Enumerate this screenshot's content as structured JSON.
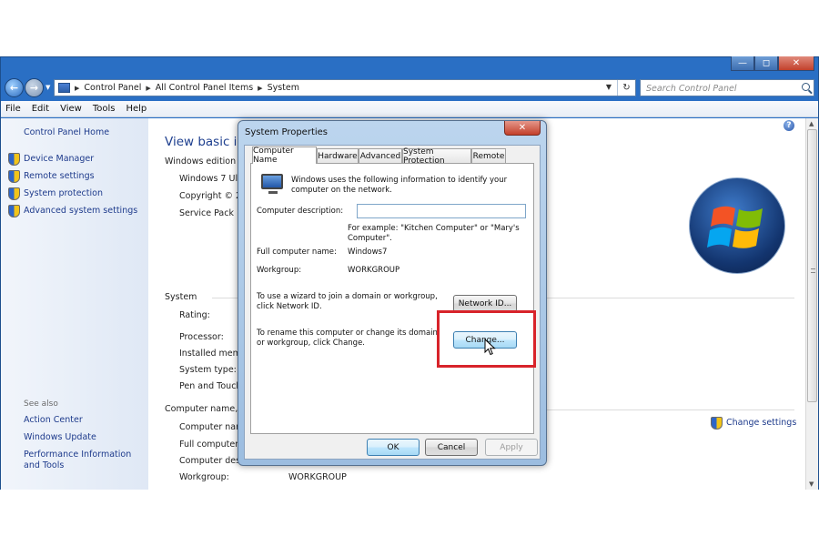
{
  "window": {
    "caption_buttons": {
      "minimize": "—",
      "maximize": "◻",
      "close": "✕"
    }
  },
  "navbar": {
    "back_glyph": "←",
    "forward_glyph": "→",
    "breadcrumb": [
      "Control Panel",
      "All Control Panel Items",
      "System"
    ],
    "search_placeholder": "Search Control Panel"
  },
  "menubar": [
    "File",
    "Edit",
    "View",
    "Tools",
    "Help"
  ],
  "left_pane": {
    "home": "Control Panel Home",
    "tasks": [
      "Device Manager",
      "Remote settings",
      "System protection",
      "Advanced system settings"
    ],
    "see_also_label": "See also",
    "see_also": [
      "Action Center",
      "Windows Update",
      "Performance Information and Tools"
    ]
  },
  "content": {
    "title": "View basic info",
    "windows_edition": {
      "header": "Windows edition",
      "rows": [
        "Windows 7 Ulti",
        "Copyright © 20",
        "Service Pack 1"
      ]
    },
    "system": {
      "header": "System",
      "rows": [
        "Rating:",
        "Processor:",
        "Installed memo",
        "System type:",
        "Pen and Touch"
      ]
    },
    "computer_name": {
      "header": "Computer name, d",
      "rows": [
        "Computer nam",
        "Full computer n",
        "Computer desc",
        "Workgroup:"
      ],
      "workgroup_value": "WORKGROUP"
    },
    "change_settings": "Change settings",
    "help_glyph": "?"
  },
  "dialog": {
    "title": "System Properties",
    "close_glyph": "✕",
    "tabs": [
      "Computer Name",
      "Hardware",
      "Advanced",
      "System Protection",
      "Remote"
    ],
    "intro": "Windows uses the following information to identify your computer on the network.",
    "description_label": "Computer description:",
    "description_value": "",
    "example": "For example: \"Kitchen Computer\" or \"Mary's Computer\".",
    "full_name_label": "Full computer name:",
    "full_name_value": "Windows7",
    "workgroup_label": "Workgroup:",
    "workgroup_value": "WORKGROUP",
    "network_id_text": "To use a wizard to join a domain or workgroup, click Network ID.",
    "network_id_button": "Network ID...",
    "rename_text": "To rename this computer or change its domain or workgroup, click Change.",
    "change_button": "Change...",
    "ok": "OK",
    "cancel": "Cancel",
    "apply": "Apply"
  },
  "colors": {
    "highlight_box": "#d8232a",
    "window_frame": "#2a6fc4",
    "link": "#1e3b8c"
  }
}
